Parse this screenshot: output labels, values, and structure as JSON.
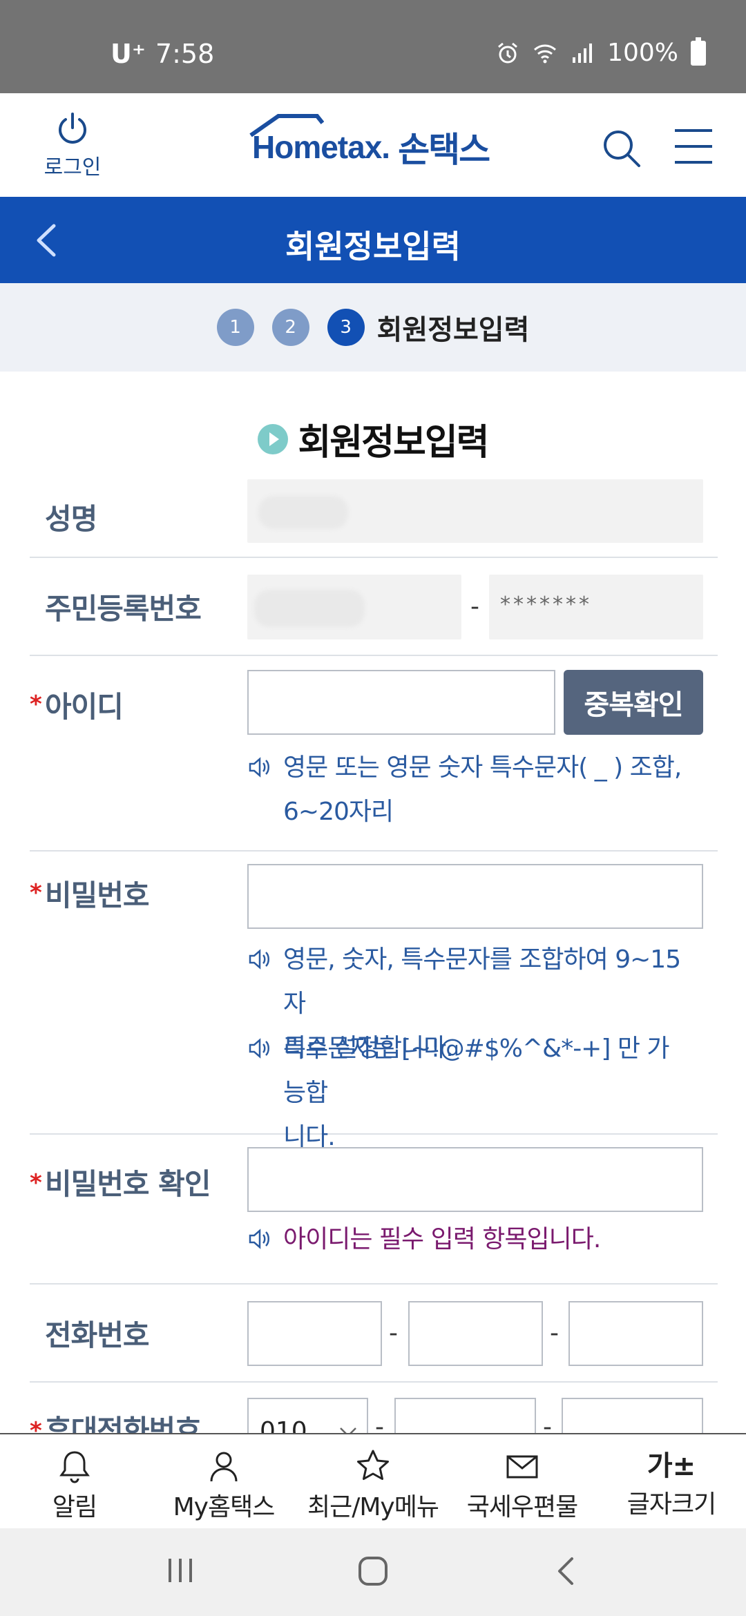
{
  "status_bar": {
    "carrier": "U⁺",
    "time": "7:58",
    "battery": "100%"
  },
  "header": {
    "login_label": "로그인",
    "logo_text_en": "Hometax.",
    "logo_text_ko": "손택스"
  },
  "title_bar": {
    "title": "회원정보입력"
  },
  "steps": {
    "items": [
      "1",
      "2",
      "3"
    ],
    "active_index": 2,
    "active_label": "회원정보입력"
  },
  "section": {
    "title": "회원정보입력"
  },
  "form": {
    "name": {
      "label": "성명",
      "value": ""
    },
    "rrn": {
      "label": "주민등록번호",
      "front": "",
      "back_masked": "*******"
    },
    "id": {
      "label": "아이디",
      "value": "",
      "check_button": "중복확인",
      "hint_line1": "영문 또는 영문 숫자 특수문자( _ ) 조합,",
      "hint_line2": "6~20자리"
    },
    "password": {
      "label": "비밀번호",
      "value": "",
      "hint1_line1": "영문, 숫자, 특수문자를 조합하여 9~15자",
      "hint1_line2": "리로 설정합니다.",
      "hint2_line1": "특수문자는 [~!@#$%^&*-+] 만 가능합",
      "hint2_line2": "니다."
    },
    "password_confirm": {
      "label": "비밀번호 확인",
      "value": "",
      "error": "아이디는 필수 입력 항목입니다."
    },
    "phone": {
      "label": "전화번호",
      "part1": "",
      "part2": "",
      "part3": ""
    },
    "mobile": {
      "label": "휴대전화번호",
      "prefix": "010",
      "part2": "",
      "part3": ""
    }
  },
  "bottom_nav": {
    "items": [
      {
        "label": "알림",
        "icon": "bell-icon"
      },
      {
        "label": "My홈택스",
        "icon": "person-icon"
      },
      {
        "label": "최근/My메뉴",
        "icon": "star-icon"
      },
      {
        "label": "국세우편물",
        "icon": "mail-icon"
      },
      {
        "label": "글자크기",
        "icon": "font-size-icon",
        "glyph": "가±"
      }
    ]
  },
  "colors": {
    "primary": "#1250b4",
    "label": "#4a5e78",
    "hint": "#2a5aa0",
    "error": "#7a1a6e",
    "required": "#dd2222",
    "button": "#55657e"
  }
}
